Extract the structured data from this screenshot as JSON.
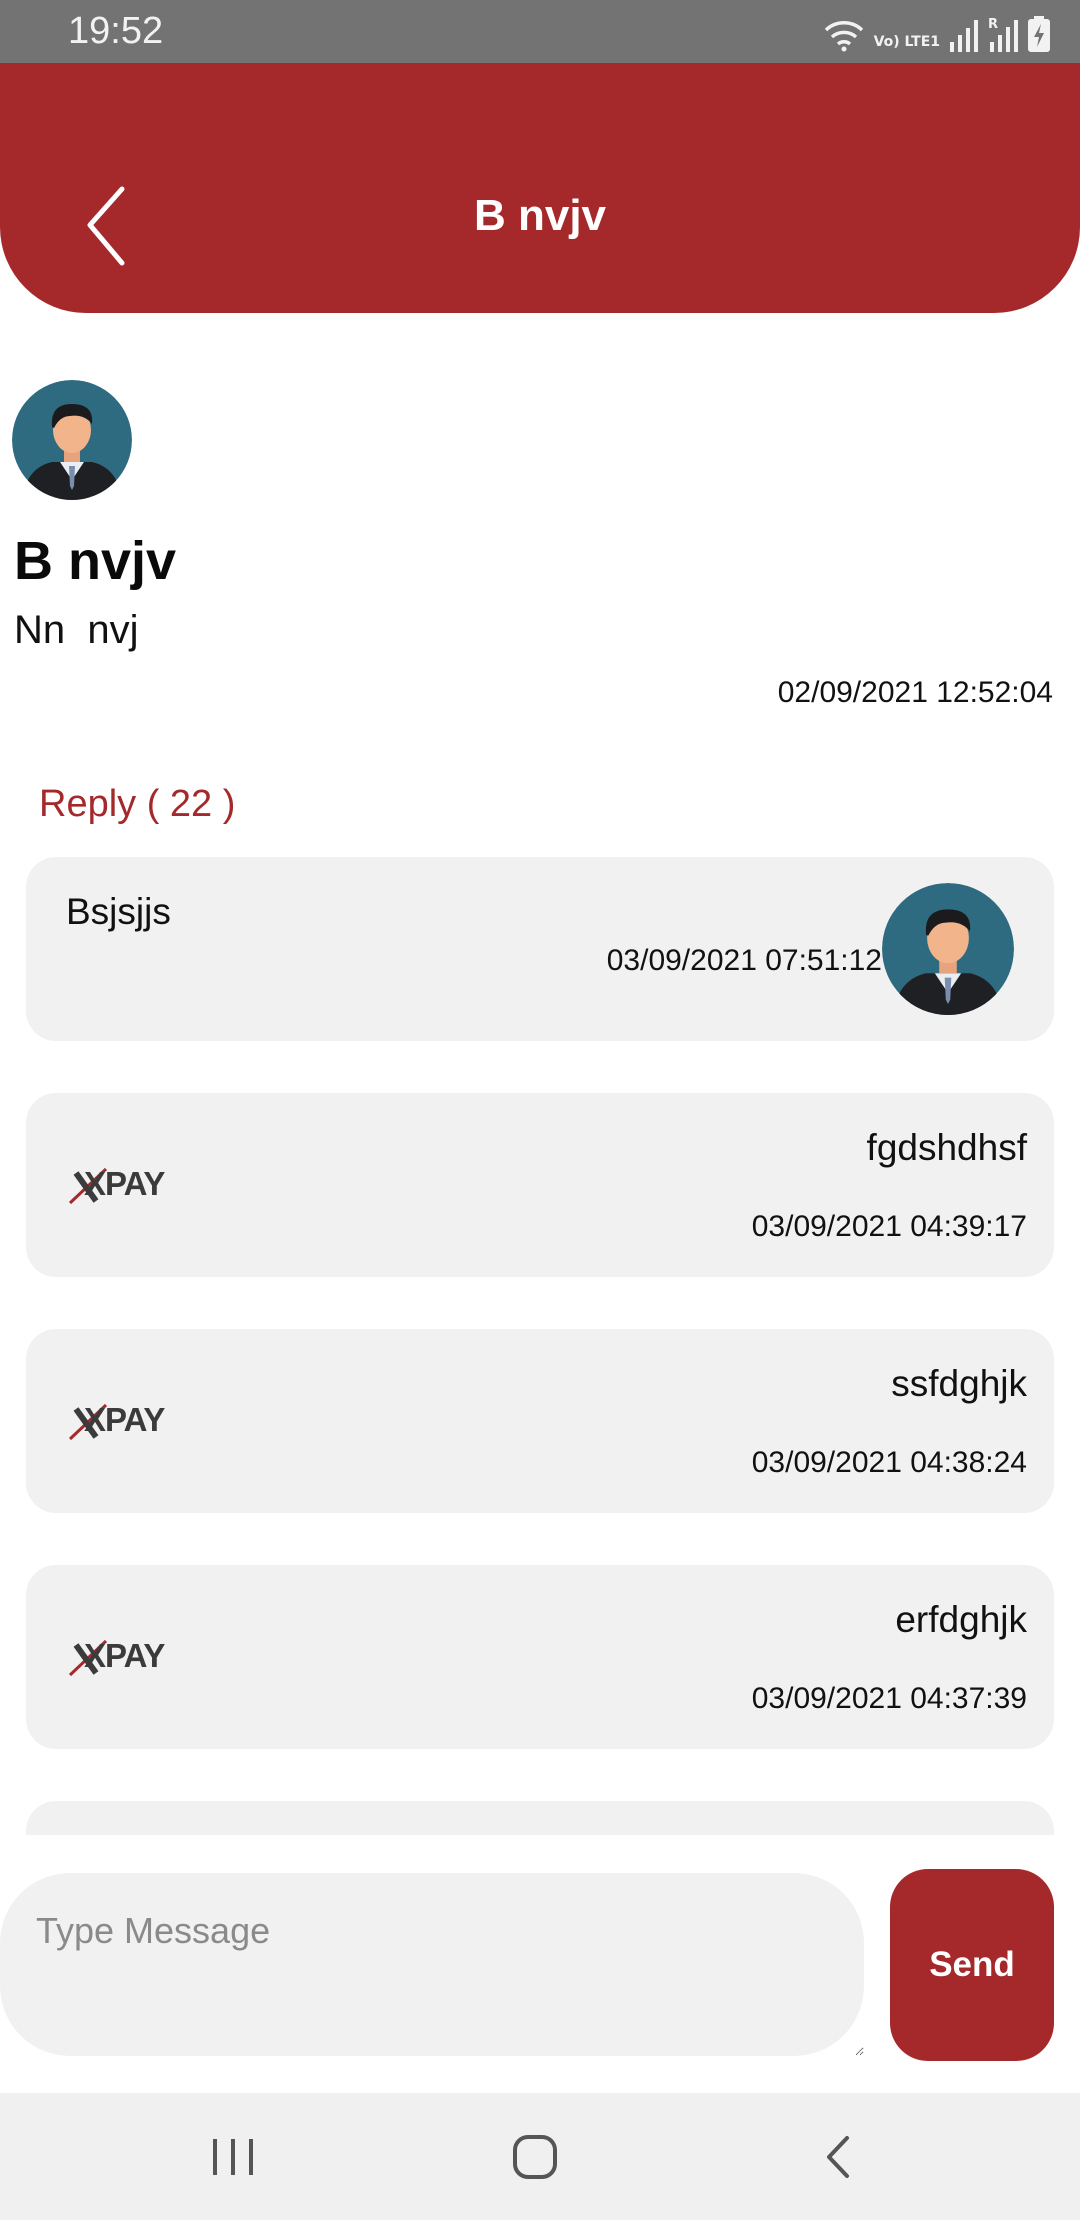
{
  "status_bar": {
    "time": "19:52",
    "network_label": "Vo) LTE1",
    "icons": [
      "wifi-icon",
      "volte-icon",
      "signal-icon",
      "roaming-signal-icon",
      "battery-charging-icon"
    ]
  },
  "header": {
    "title": "B nvjv",
    "back_icon": "chevron-left-icon",
    "background_color": "#a5292b"
  },
  "post": {
    "author": "B nvjv",
    "body": "Nn  nvj",
    "timestamp": "02/09/2021 12:52:04",
    "avatar_icon": "businessman-avatar"
  },
  "replies": {
    "label": "Reply ( 22 )",
    "items": [
      {
        "type": "user",
        "text": "Bsjsjjs",
        "timestamp": "03/09/2021 07:51:12",
        "avatar_icon": "businessman-avatar"
      },
      {
        "type": "admin",
        "text": "fgdshdhsf",
        "timestamp": "03/09/2021 04:39:17",
        "logo": "XPAY"
      },
      {
        "type": "admin",
        "text": "ssfdghjk",
        "timestamp": "03/09/2021 04:38:24",
        "logo": "XPAY"
      },
      {
        "type": "admin",
        "text": "erfdghjk",
        "timestamp": "03/09/2021 04:37:39",
        "logo": "XPAY"
      }
    ]
  },
  "compose": {
    "placeholder": "Type Message",
    "value": "",
    "send_label": "Send"
  },
  "nav_bar": {
    "buttons": [
      "recent-apps-icon",
      "home-icon",
      "back-icon"
    ]
  },
  "colors": {
    "accent": "#a5292b",
    "card_background": "#f1f1f1",
    "status_bar": "#737373"
  }
}
